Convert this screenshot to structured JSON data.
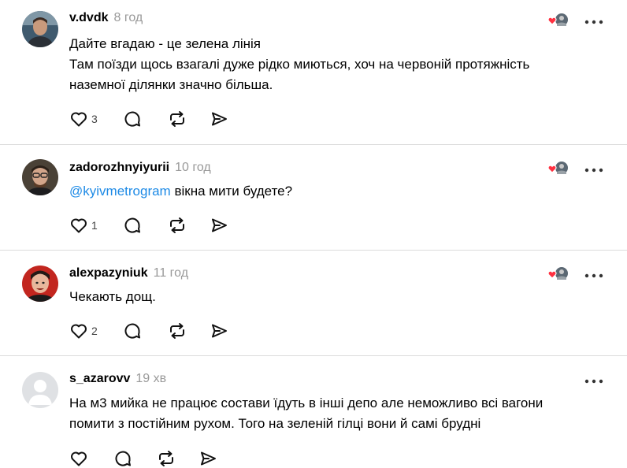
{
  "comments": [
    {
      "username": "v.dvdk",
      "time": "8 год",
      "lines": [
        "Дайте вгадаю - це зелена лінія",
        "Там поїзди щось взагалі дуже рідко миються, хоч на червоній протяжність",
        "наземної ділянки значно більша."
      ],
      "likes": "3",
      "liked_by_creator": true,
      "avatar": "photo-young-man"
    },
    {
      "username": "zadorozhnyiyurii",
      "time": "10 год",
      "mention": "@kyivmetrogram",
      "text": " вікна мити будете?",
      "likes": "1",
      "liked_by_creator": true,
      "avatar": "photo-man-glasses"
    },
    {
      "username": "alexpazyniuk",
      "time": "11 год",
      "lines": [
        "Чекають дощ."
      ],
      "likes": "2",
      "liked_by_creator": true,
      "avatar": "photo-man-red"
    },
    {
      "username": "s_azarovv",
      "time": "19 хв",
      "lines": [
        "На м3 мийка не працює состави їдуть в інші депо але неможливо всі вагони",
        "помити з постійним рухом. Того на зеленій гілці вони й самі брудні"
      ],
      "likes": "",
      "liked_by_creator": false,
      "avatar": "default-avatar"
    }
  ],
  "icons": {
    "like": "heart-icon",
    "reply": "comment-bubble-icon",
    "repost": "repost-icon",
    "share": "send-icon",
    "more": "more-dots-icon",
    "creator_like": "creator-liked-heart-icon"
  },
  "colors": {
    "mention": "#1d8ae6",
    "creator_heart": "#ff3040",
    "muted": "#999999"
  }
}
